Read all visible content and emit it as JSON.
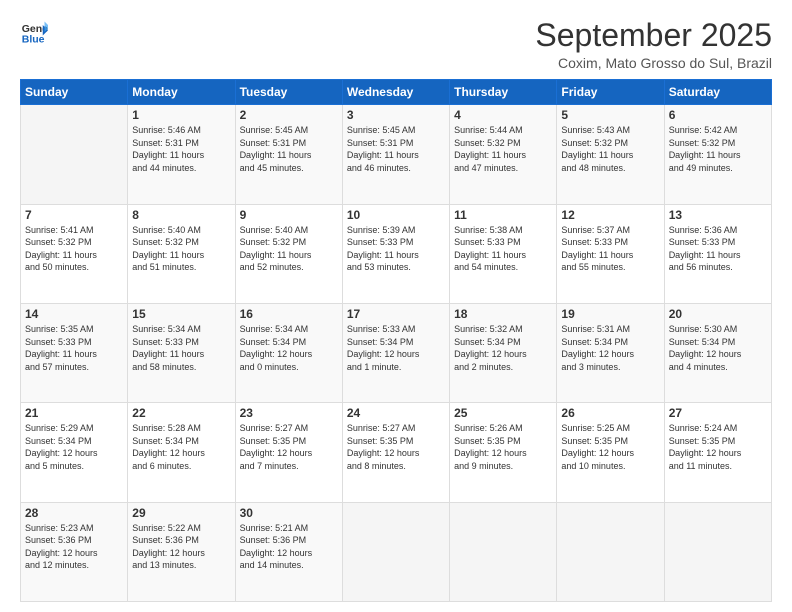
{
  "logo": {
    "line1": "General",
    "line2": "Blue"
  },
  "title": "September 2025",
  "location": "Coxim, Mato Grosso do Sul, Brazil",
  "days_header": [
    "Sunday",
    "Monday",
    "Tuesday",
    "Wednesday",
    "Thursday",
    "Friday",
    "Saturday"
  ],
  "weeks": [
    [
      {
        "day": "",
        "info": ""
      },
      {
        "day": "1",
        "info": "Sunrise: 5:46 AM\nSunset: 5:31 PM\nDaylight: 11 hours\nand 44 minutes."
      },
      {
        "day": "2",
        "info": "Sunrise: 5:45 AM\nSunset: 5:31 PM\nDaylight: 11 hours\nand 45 minutes."
      },
      {
        "day": "3",
        "info": "Sunrise: 5:45 AM\nSunset: 5:31 PM\nDaylight: 11 hours\nand 46 minutes."
      },
      {
        "day": "4",
        "info": "Sunrise: 5:44 AM\nSunset: 5:32 PM\nDaylight: 11 hours\nand 47 minutes."
      },
      {
        "day": "5",
        "info": "Sunrise: 5:43 AM\nSunset: 5:32 PM\nDaylight: 11 hours\nand 48 minutes."
      },
      {
        "day": "6",
        "info": "Sunrise: 5:42 AM\nSunset: 5:32 PM\nDaylight: 11 hours\nand 49 minutes."
      }
    ],
    [
      {
        "day": "7",
        "info": "Sunrise: 5:41 AM\nSunset: 5:32 PM\nDaylight: 11 hours\nand 50 minutes."
      },
      {
        "day": "8",
        "info": "Sunrise: 5:40 AM\nSunset: 5:32 PM\nDaylight: 11 hours\nand 51 minutes."
      },
      {
        "day": "9",
        "info": "Sunrise: 5:40 AM\nSunset: 5:32 PM\nDaylight: 11 hours\nand 52 minutes."
      },
      {
        "day": "10",
        "info": "Sunrise: 5:39 AM\nSunset: 5:33 PM\nDaylight: 11 hours\nand 53 minutes."
      },
      {
        "day": "11",
        "info": "Sunrise: 5:38 AM\nSunset: 5:33 PM\nDaylight: 11 hours\nand 54 minutes."
      },
      {
        "day": "12",
        "info": "Sunrise: 5:37 AM\nSunset: 5:33 PM\nDaylight: 11 hours\nand 55 minutes."
      },
      {
        "day": "13",
        "info": "Sunrise: 5:36 AM\nSunset: 5:33 PM\nDaylight: 11 hours\nand 56 minutes."
      }
    ],
    [
      {
        "day": "14",
        "info": "Sunrise: 5:35 AM\nSunset: 5:33 PM\nDaylight: 11 hours\nand 57 minutes."
      },
      {
        "day": "15",
        "info": "Sunrise: 5:34 AM\nSunset: 5:33 PM\nDaylight: 11 hours\nand 58 minutes."
      },
      {
        "day": "16",
        "info": "Sunrise: 5:34 AM\nSunset: 5:34 PM\nDaylight: 12 hours\nand 0 minutes."
      },
      {
        "day": "17",
        "info": "Sunrise: 5:33 AM\nSunset: 5:34 PM\nDaylight: 12 hours\nand 1 minute."
      },
      {
        "day": "18",
        "info": "Sunrise: 5:32 AM\nSunset: 5:34 PM\nDaylight: 12 hours\nand 2 minutes."
      },
      {
        "day": "19",
        "info": "Sunrise: 5:31 AM\nSunset: 5:34 PM\nDaylight: 12 hours\nand 3 minutes."
      },
      {
        "day": "20",
        "info": "Sunrise: 5:30 AM\nSunset: 5:34 PM\nDaylight: 12 hours\nand 4 minutes."
      }
    ],
    [
      {
        "day": "21",
        "info": "Sunrise: 5:29 AM\nSunset: 5:34 PM\nDaylight: 12 hours\nand 5 minutes."
      },
      {
        "day": "22",
        "info": "Sunrise: 5:28 AM\nSunset: 5:34 PM\nDaylight: 12 hours\nand 6 minutes."
      },
      {
        "day": "23",
        "info": "Sunrise: 5:27 AM\nSunset: 5:35 PM\nDaylight: 12 hours\nand 7 minutes."
      },
      {
        "day": "24",
        "info": "Sunrise: 5:27 AM\nSunset: 5:35 PM\nDaylight: 12 hours\nand 8 minutes."
      },
      {
        "day": "25",
        "info": "Sunrise: 5:26 AM\nSunset: 5:35 PM\nDaylight: 12 hours\nand 9 minutes."
      },
      {
        "day": "26",
        "info": "Sunrise: 5:25 AM\nSunset: 5:35 PM\nDaylight: 12 hours\nand 10 minutes."
      },
      {
        "day": "27",
        "info": "Sunrise: 5:24 AM\nSunset: 5:35 PM\nDaylight: 12 hours\nand 11 minutes."
      }
    ],
    [
      {
        "day": "28",
        "info": "Sunrise: 5:23 AM\nSunset: 5:36 PM\nDaylight: 12 hours\nand 12 minutes."
      },
      {
        "day": "29",
        "info": "Sunrise: 5:22 AM\nSunset: 5:36 PM\nDaylight: 12 hours\nand 13 minutes."
      },
      {
        "day": "30",
        "info": "Sunrise: 5:21 AM\nSunset: 5:36 PM\nDaylight: 12 hours\nand 14 minutes."
      },
      {
        "day": "",
        "info": ""
      },
      {
        "day": "",
        "info": ""
      },
      {
        "day": "",
        "info": ""
      },
      {
        "day": "",
        "info": ""
      }
    ]
  ]
}
